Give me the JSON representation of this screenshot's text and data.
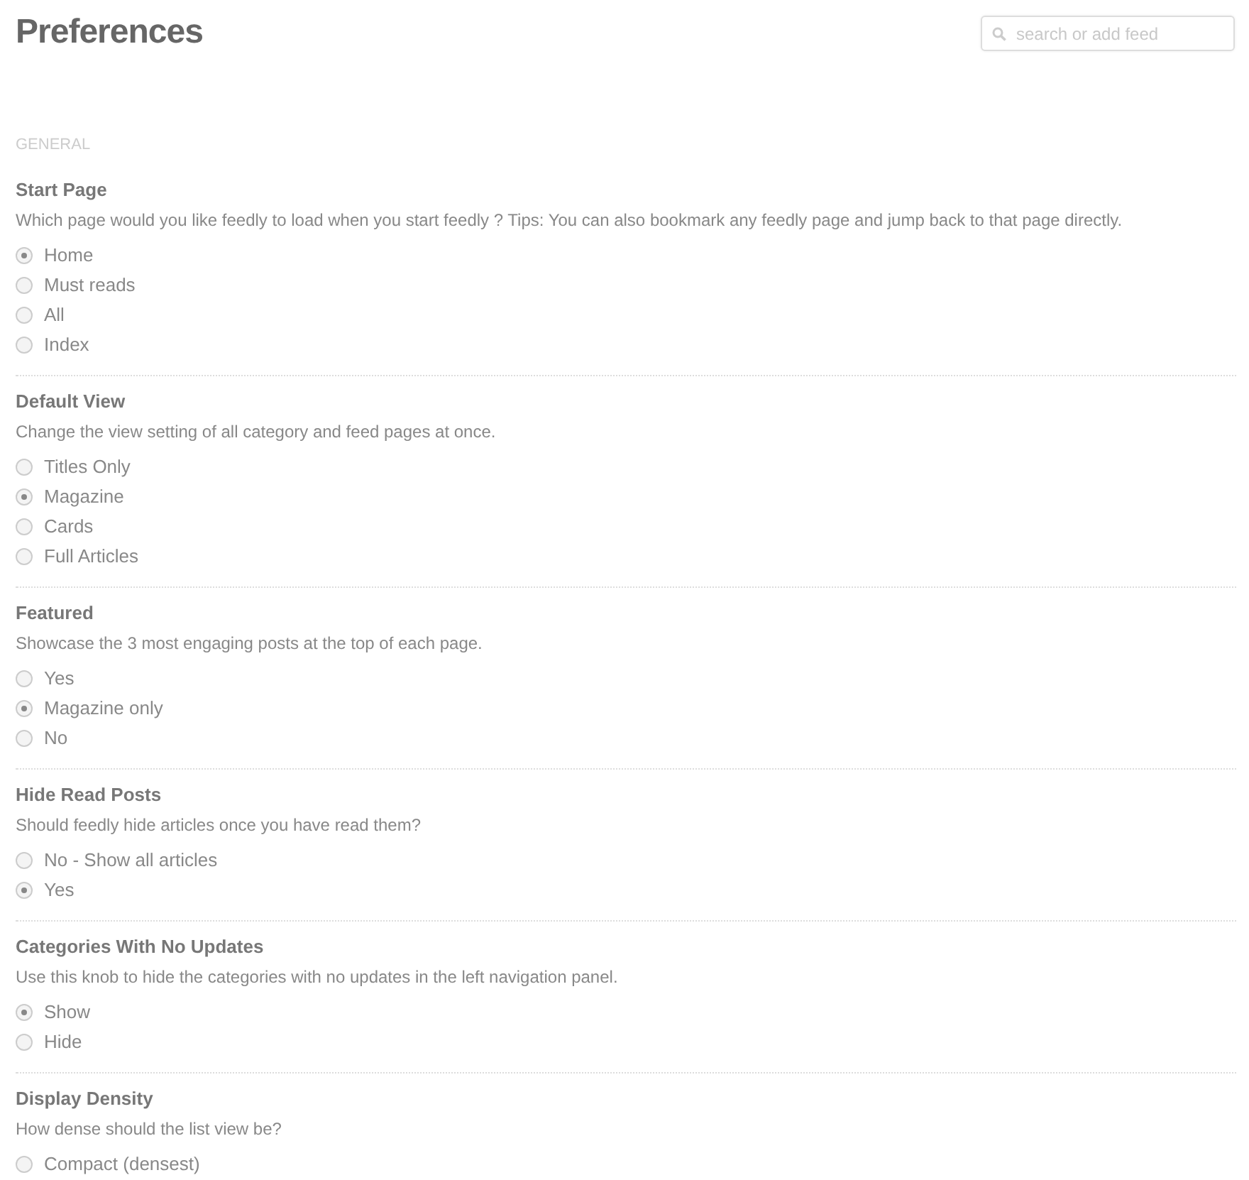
{
  "title": "Preferences",
  "search": {
    "placeholder": "search or add feed"
  },
  "section_label": "GENERAL",
  "settings": [
    {
      "title": "Start Page",
      "description": "Which page would you like feedly to load when you start feedly ? Tips: You can also bookmark any feedly page and jump back to that page directly.",
      "options": [
        {
          "label": "Home",
          "selected": true
        },
        {
          "label": "Must reads",
          "selected": false
        },
        {
          "label": "All",
          "selected": false
        },
        {
          "label": "Index",
          "selected": false
        }
      ]
    },
    {
      "title": "Default View",
      "description": "Change the view setting of all category and feed pages at once.",
      "options": [
        {
          "label": "Titles Only",
          "selected": false
        },
        {
          "label": "Magazine",
          "selected": true
        },
        {
          "label": "Cards",
          "selected": false
        },
        {
          "label": "Full Articles",
          "selected": false
        }
      ]
    },
    {
      "title": "Featured",
      "description": "Showcase the 3 most engaging posts at the top of each page.",
      "options": [
        {
          "label": "Yes",
          "selected": false
        },
        {
          "label": "Magazine only",
          "selected": true
        },
        {
          "label": "No",
          "selected": false
        }
      ]
    },
    {
      "title": "Hide Read Posts",
      "description": "Should feedly hide articles once you have read them?",
      "options": [
        {
          "label": "No - Show all articles",
          "selected": false
        },
        {
          "label": "Yes",
          "selected": true
        }
      ]
    },
    {
      "title": "Categories With No Updates",
      "description": "Use this knob to hide the categories with no updates in the left navigation panel.",
      "options": [
        {
          "label": "Show",
          "selected": true
        },
        {
          "label": "Hide",
          "selected": false
        }
      ]
    },
    {
      "title": "Display Density",
      "description": "How dense should the list view be?",
      "options": [
        {
          "label": "Compact (densest)",
          "selected": false
        }
      ]
    }
  ]
}
